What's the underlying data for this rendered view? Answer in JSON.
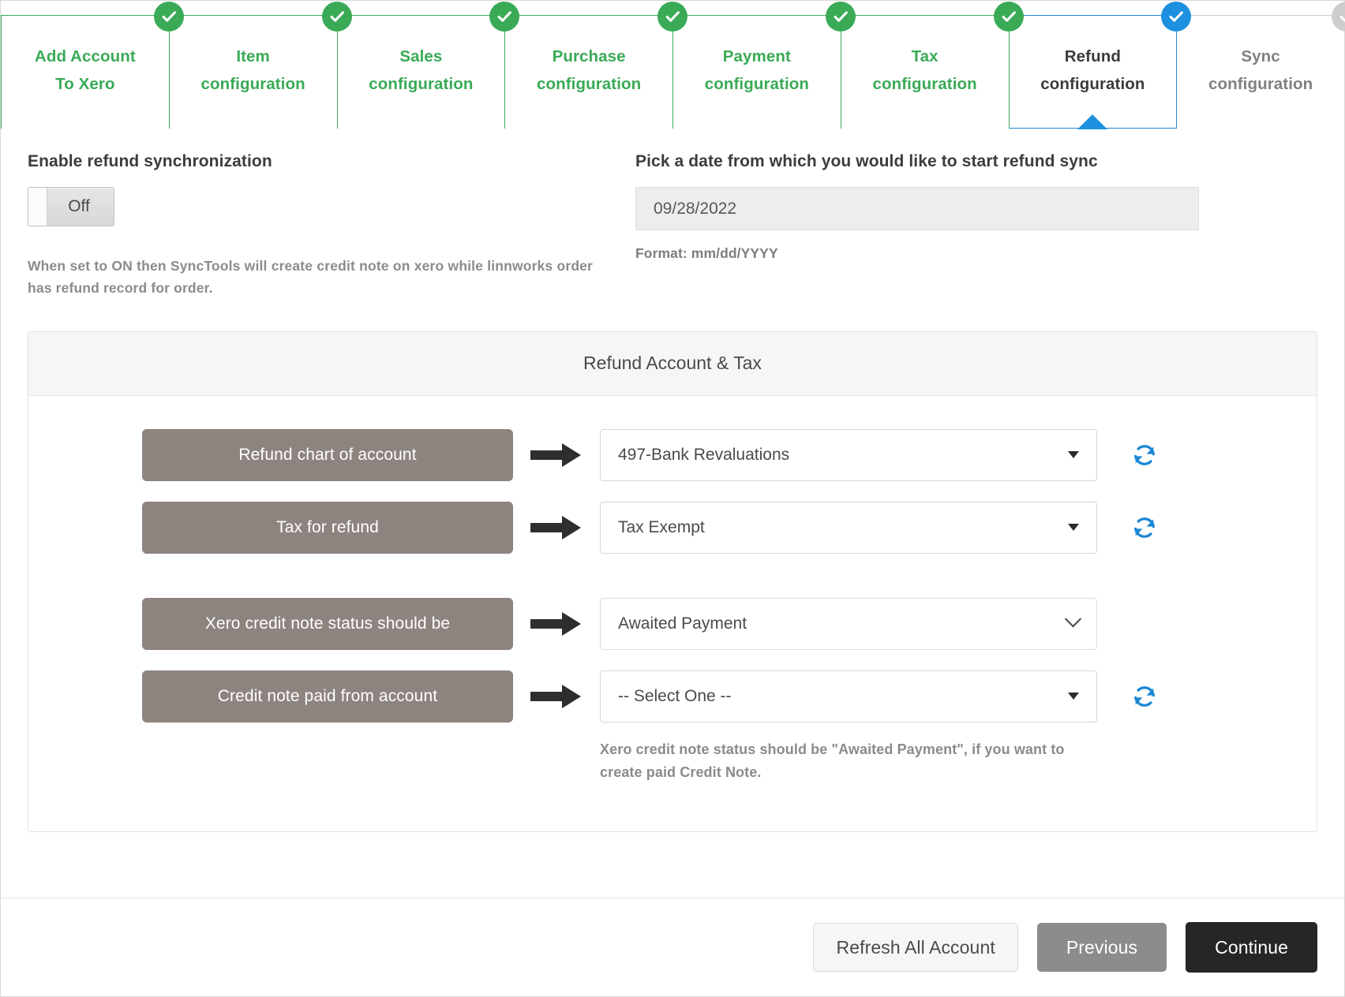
{
  "stepper": {
    "steps": [
      {
        "label": "Add Account\nTo Xero",
        "state": "done"
      },
      {
        "label": "Item\nconfiguration",
        "state": "done"
      },
      {
        "label": "Sales\nconfiguration",
        "state": "done"
      },
      {
        "label": "Purchase\nconfiguration",
        "state": "done"
      },
      {
        "label": "Payment\nconfiguration",
        "state": "done"
      },
      {
        "label": "Tax\nconfiguration",
        "state": "done"
      },
      {
        "label": "Refund\nconfiguration",
        "state": "active"
      },
      {
        "label": "Sync\nconfiguration",
        "state": "pending"
      }
    ],
    "colors": {
      "done": "#3aaa56",
      "active": "#1d90e0",
      "pending": "#cdcdcd"
    }
  },
  "refund_sync": {
    "title": "Enable refund synchronization",
    "toggle_value": "Off",
    "hint": "When set to ON then SyncTools will create credit note on xero while linnworks order has refund record for order."
  },
  "date_picker": {
    "title": "Pick a date from which you would like to start refund sync",
    "value": "09/28/2022",
    "format_note": "Format: mm/dd/YYYY"
  },
  "panel": {
    "title": "Refund Account & Tax",
    "rows": [
      {
        "label": "Refund chart of account",
        "value": "497-Bank Revaluations",
        "control": "dropdown",
        "refresh": true
      },
      {
        "label": "Tax for refund",
        "value": "Tax Exempt",
        "control": "dropdown",
        "refresh": true
      },
      {
        "label": "Xero credit note status should be",
        "value": "Awaited Payment",
        "control": "native-select",
        "refresh": false
      },
      {
        "label": "Credit note paid from account",
        "value": "-- Select One --",
        "control": "dropdown",
        "refresh": true,
        "note": "Xero credit note status should be \"Awaited Payment\", if you want to create paid Credit Note."
      }
    ]
  },
  "footer": {
    "refresh_all_label": "Refresh All Account",
    "previous_label": "Previous",
    "continue_label": "Continue"
  },
  "icons": {
    "check": "check-icon",
    "refresh": "refresh-icon",
    "arrow": "arrow-right-icon",
    "caret": "chevron-down-icon"
  }
}
